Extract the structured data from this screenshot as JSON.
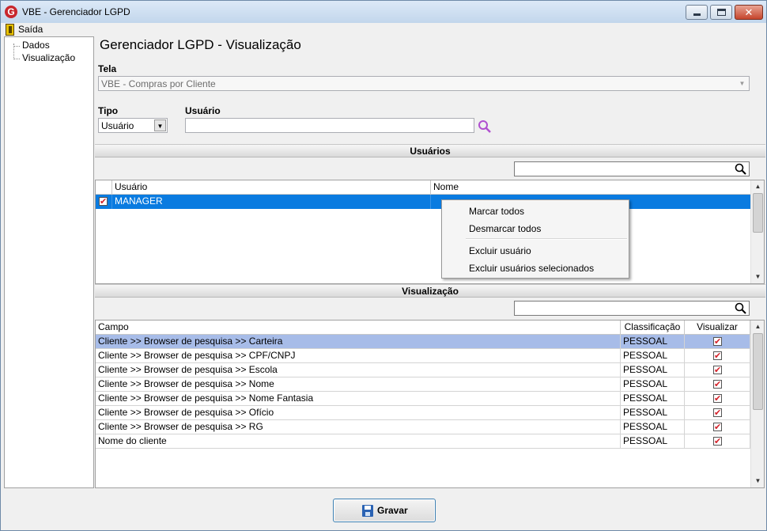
{
  "window": {
    "title": "VBE - Gerenciador LGPD",
    "app_icon_glyph": "G",
    "controls": {
      "minimize": "minimize-icon",
      "maximize": "restore-icon",
      "close": "✕"
    }
  },
  "menu": {
    "exit_label": "Saída"
  },
  "tree": {
    "items": [
      "Dados",
      "Visualização"
    ]
  },
  "page": {
    "title": "Gerenciador LGPD - Visualização",
    "tela_label": "Tela",
    "tela_value": "VBE - Compras por Cliente",
    "tipo_label": "Tipo",
    "tipo_value": "Usuário",
    "usuario_label": "Usuário",
    "usuario_value": ""
  },
  "usuarios": {
    "section_title": "Usuários",
    "search_value": "",
    "columns": [
      "Usuário",
      "Nome"
    ],
    "rows": [
      {
        "checked": true,
        "usuario": "MANAGER",
        "nome": ""
      }
    ]
  },
  "context_menu": {
    "items": [
      "Marcar todos",
      "Desmarcar todos",
      "Excluir usuário",
      "Excluir usuários selecionados"
    ]
  },
  "visualizacao": {
    "section_title": "Visualização",
    "search_value": "",
    "columns": [
      "Campo",
      "Classificação",
      "Visualizar"
    ],
    "rows": [
      {
        "campo": "Cliente >> Browser de pesquisa >> Carteira",
        "classificacao": "PESSOAL",
        "visualizar": true
      },
      {
        "campo": "Cliente >> Browser de pesquisa >> CPF/CNPJ",
        "classificacao": "PESSOAL",
        "visualizar": true
      },
      {
        "campo": "Cliente >> Browser de pesquisa >> Escola",
        "classificacao": "PESSOAL",
        "visualizar": true
      },
      {
        "campo": "Cliente >> Browser de pesquisa >> Nome",
        "classificacao": "PESSOAL",
        "visualizar": true
      },
      {
        "campo": "Cliente >> Browser de pesquisa >> Nome Fantasia",
        "classificacao": "PESSOAL",
        "visualizar": true
      },
      {
        "campo": "Cliente >> Browser de pesquisa >> Ofício",
        "classificacao": "PESSOAL",
        "visualizar": true
      },
      {
        "campo": "Cliente >> Browser de pesquisa >> RG",
        "classificacao": "PESSOAL",
        "visualizar": true
      },
      {
        "campo": "Nome do cliente",
        "classificacao": "PESSOAL",
        "visualizar": true
      }
    ]
  },
  "footer": {
    "save_label": "Gravar"
  },
  "colors": {
    "selection_blue": "#0a7be0",
    "selection_light": "#a7bce8",
    "check_red": "#d4222a",
    "search_icon": "#b050d0"
  }
}
